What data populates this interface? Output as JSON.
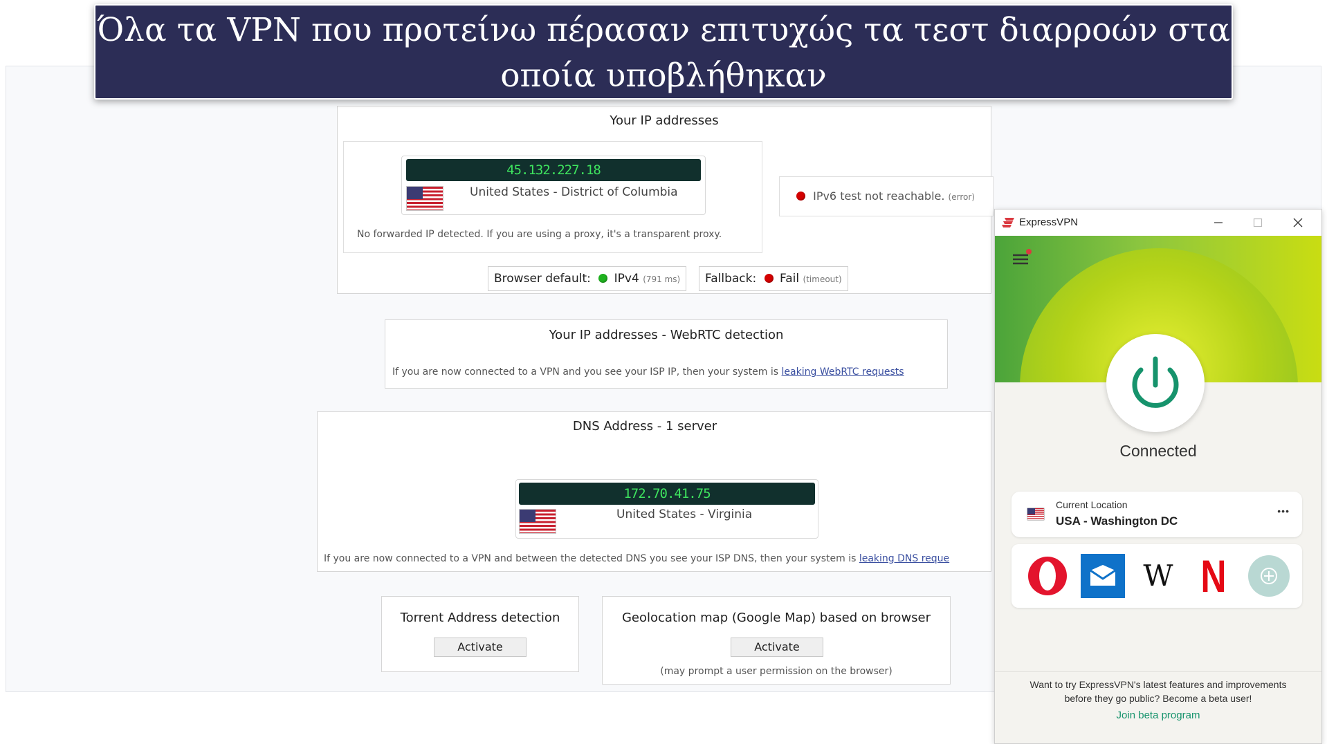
{
  "banner": {
    "line1": "Όλα τα VPN που προτείνω πέρασαν επιτυχώς τα τεστ διαρροών στα",
    "line2": "οποία υποβλήθηκαν"
  },
  "ip_section": {
    "title": "Your IP addresses",
    "ip": "45.132.227.18",
    "location": "United States - District of Columbia",
    "forwarded_note": "No forwarded IP detected. If you are using a proxy, it's a transparent proxy.",
    "ipv6_text": "IPv6 test not reachable.",
    "ipv6_error": "(error)",
    "browser_default_label": "Browser default:",
    "ipv4_label": "IPv4",
    "ipv4_ms": "(791 ms)",
    "fallback_label": "Fallback:",
    "fail_label": "Fail",
    "fail_note": "(timeout)"
  },
  "webrtc_section": {
    "title": "Your IP addresses - WebRTC detection",
    "note": "If you are now connected to a VPN and you see your ISP IP, then your system is",
    "link": "leaking WebRTC requests"
  },
  "dns_section": {
    "title": "DNS Address - 1 server",
    "ip": "172.70.41.75",
    "location": "United States - Virginia",
    "note": "If you are now connected to a VPN and between the detected DNS you see your ISP DNS, then your system is",
    "link": "leaking DNS reque"
  },
  "torrent_section": {
    "title": "Torrent Address detection",
    "button": "Activate"
  },
  "geo_section": {
    "title": "Geolocation map (Google Map) based on browser",
    "button": "Activate",
    "note": "(may prompt a user permission on the browser)"
  },
  "expressvpn": {
    "app_title": "ExpressVPN",
    "status": "Connected",
    "current_location_label": "Current Location",
    "current_location": "USA - Washington DC",
    "more_glyph": "•••",
    "shortcuts": [
      "opera-icon",
      "mail-icon",
      "wikipedia-icon",
      "netflix-icon",
      "add-shortcut-icon"
    ],
    "wiki_glyph": "W",
    "netflix_glyph": "N",
    "beta_text": "Want to try ExpressVPN's latest features and improvements before they go public? Become a beta user!",
    "beta_link": "Join beta program",
    "colors": {
      "accent": "#16936c",
      "brand_red": "#da3940",
      "hero_green": "#8cc63f",
      "banner": "#2c2d56"
    }
  }
}
